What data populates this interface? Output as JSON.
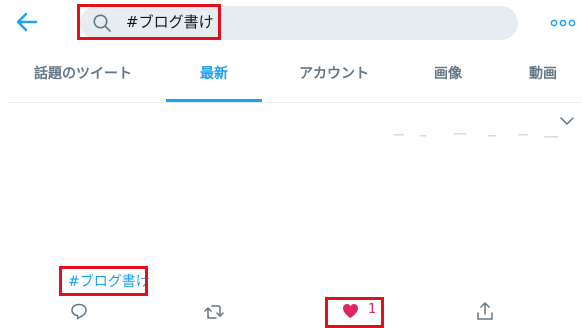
{
  "header": {
    "back_icon": "arrow-left-icon",
    "search": {
      "icon": "search-icon",
      "query": "#ブログ書け"
    },
    "more_icon": "more-horizontal-icon"
  },
  "tabs": [
    {
      "label": "話題のツイート",
      "active": false
    },
    {
      "label": "最新",
      "active": true
    },
    {
      "label": "アカウント",
      "active": false
    },
    {
      "label": "画像",
      "active": false
    },
    {
      "label": "動画",
      "active": false
    }
  ],
  "tweet": {
    "hashtag": "#ブログ書け",
    "actions": {
      "reply_icon": "reply-icon",
      "retweet_icon": "retweet-icon",
      "like_icon": "heart-icon",
      "like_count": "1",
      "share_icon": "share-icon"
    }
  },
  "colors": {
    "accent": "#1da1f2",
    "like": "#e0245e",
    "highlight_box": "#e0101c",
    "search_bg": "#e6ecf0",
    "muted_text": "#657786"
  }
}
